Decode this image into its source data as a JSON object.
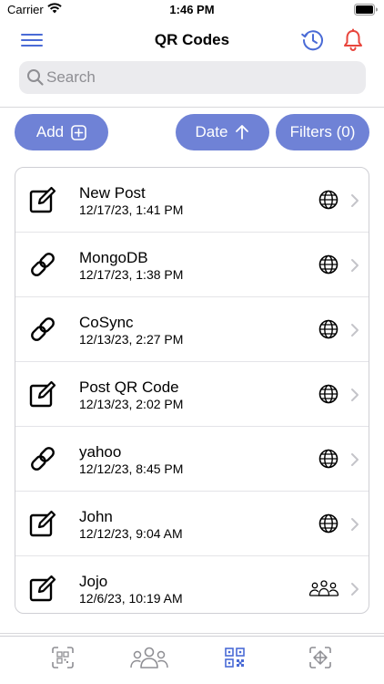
{
  "status_bar": {
    "carrier": "Carrier",
    "time": "1:46 PM"
  },
  "nav": {
    "title": "QR Codes",
    "menu_icon": "hamburger-menu-icon",
    "history_icon": "history-clock-icon",
    "notifications_icon": "bell-icon"
  },
  "search": {
    "placeholder": "Search",
    "value": ""
  },
  "toolbar": {
    "add_label": "Add",
    "sort_label": "Date",
    "sort_direction": "ascending",
    "filters_label": "Filters (0)"
  },
  "items": [
    {
      "title": "New Post",
      "date": "12/17/23, 1:41 PM",
      "type_icon": "edit-note-icon",
      "visibility_icon": "globe-icon"
    },
    {
      "title": "MongoDB",
      "date": "12/17/23, 1:38 PM",
      "type_icon": "link-icon",
      "visibility_icon": "globe-icon"
    },
    {
      "title": "CoSync",
      "date": "12/13/23, 2:27 PM",
      "type_icon": "link-icon",
      "visibility_icon": "globe-icon"
    },
    {
      "title": "Post QR Code",
      "date": "12/13/23, 2:02 PM",
      "type_icon": "edit-note-icon",
      "visibility_icon": "globe-icon"
    },
    {
      "title": "yahoo",
      "date": "12/12/23, 8:45 PM",
      "type_icon": "link-icon",
      "visibility_icon": "globe-icon"
    },
    {
      "title": "John",
      "date": "12/12/23, 9:04 AM",
      "type_icon": "edit-note-icon",
      "visibility_icon": "globe-icon"
    },
    {
      "title": "Jojo",
      "date": "12/6/23, 10:19 AM",
      "type_icon": "edit-note-icon",
      "visibility_icon": "group-icon"
    }
  ],
  "tabs": [
    {
      "icon": "scan-qr-icon",
      "selected": false
    },
    {
      "icon": "people-icon",
      "selected": false
    },
    {
      "icon": "qr-code-icon",
      "selected": true
    },
    {
      "icon": "scan-expand-icon",
      "selected": false
    }
  ],
  "colors": {
    "accent": "#6f82d6",
    "icon_blue": "#4a6bd6",
    "bell_red": "#e8453c",
    "selected_tab": "#4a6bd6",
    "unselected_tab": "#8e8e93"
  }
}
